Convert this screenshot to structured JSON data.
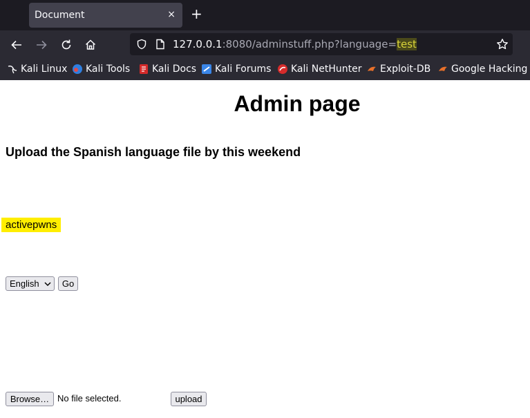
{
  "browser": {
    "tab_title": "Document",
    "tab_close": "×",
    "new_tab": "+",
    "url": {
      "host": "127.0.0.1",
      "path": ":8080/adminstuff.php?language=",
      "param_value": "test"
    },
    "bookmarks": [
      {
        "label": "Kali Linux",
        "icon": "kali-dragon-icon"
      },
      {
        "label": "Kali Tools",
        "icon": "kali-tools-icon"
      },
      {
        "label": "Kali Docs",
        "icon": "kali-docs-icon"
      },
      {
        "label": "Kali Forums",
        "icon": "kali-forums-icon"
      },
      {
        "label": "Kali NetHunter",
        "icon": "kali-nethunter-icon"
      },
      {
        "label": "Exploit-DB",
        "icon": "exploit-db-icon"
      },
      {
        "label": "Google Hacking D",
        "icon": "google-hacking-icon"
      }
    ]
  },
  "page": {
    "title": "Admin page",
    "subtitle": "Upload the Spanish language file by this weekend",
    "highlighted_text": "activepwns",
    "language_select": {
      "selected": "English"
    },
    "go_label": "Go",
    "browse_label": "Browse…",
    "file_status": "No file selected.",
    "upload_label": "upload"
  },
  "colors": {
    "tabbar_bg": "#1c1b22",
    "toolbar_bg": "#2b2a33",
    "highlight": "#ffee00",
    "url_highlight": "#d9d43a"
  }
}
